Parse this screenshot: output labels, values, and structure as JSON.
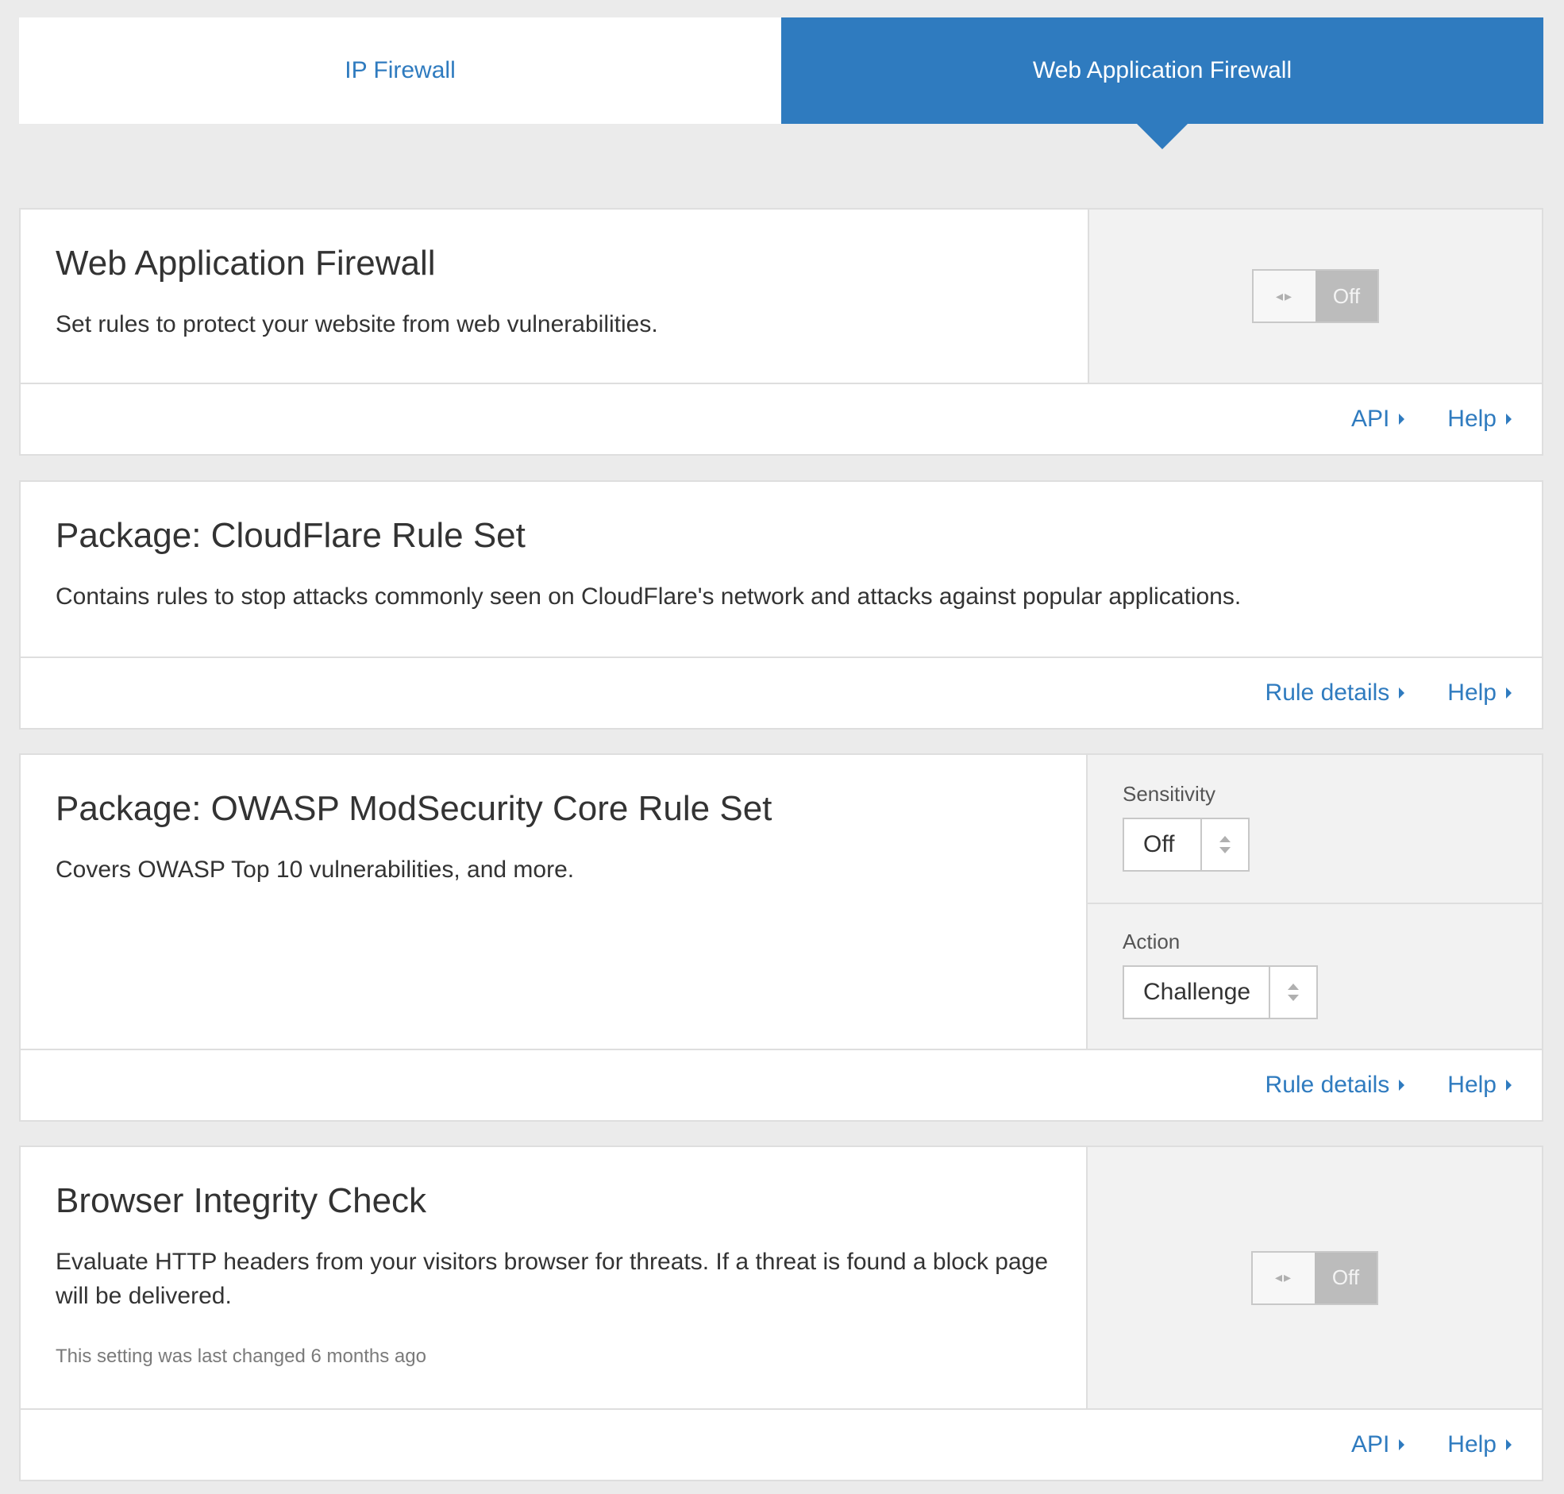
{
  "tabs": [
    {
      "label": "IP Firewall",
      "active": false
    },
    {
      "label": "Web Application Firewall",
      "active": true
    }
  ],
  "colors": {
    "accent": "#2f7bbf",
    "background": "#ebebeb",
    "toggle_off": "#bcbcbc"
  },
  "cards": {
    "waf": {
      "title": "Web Application Firewall",
      "description": "Set rules to protect your website from web vulnerabilities.",
      "toggle": {
        "icon": "arrows-left-right-icon",
        "state_label": "Off"
      },
      "links": {
        "api": "API",
        "help": "Help"
      }
    },
    "cloudflare_pkg": {
      "title": "Package: CloudFlare Rule Set",
      "description": "Contains rules to stop attacks commonly seen on CloudFlare's network and attacks against popular applications.",
      "links": {
        "rule_details": "Rule details",
        "help": "Help"
      }
    },
    "owasp_pkg": {
      "title": "Package: OWASP ModSecurity Core Rule Set",
      "description": "Covers OWASP Top 10 vulnerabilities, and more.",
      "sensitivity": {
        "label": "Sensitivity",
        "value": "Off"
      },
      "action": {
        "label": "Action",
        "value": "Challenge"
      },
      "links": {
        "rule_details": "Rule details",
        "help": "Help"
      }
    },
    "bic": {
      "title": "Browser Integrity Check",
      "description": "Evaluate HTTP headers from your visitors browser for threats. If a threat is found a block page will be delivered.",
      "note": "This setting was last changed 6 months ago",
      "toggle": {
        "icon": "arrows-left-right-icon",
        "state_label": "Off"
      },
      "links": {
        "api": "API",
        "help": "Help"
      }
    }
  }
}
